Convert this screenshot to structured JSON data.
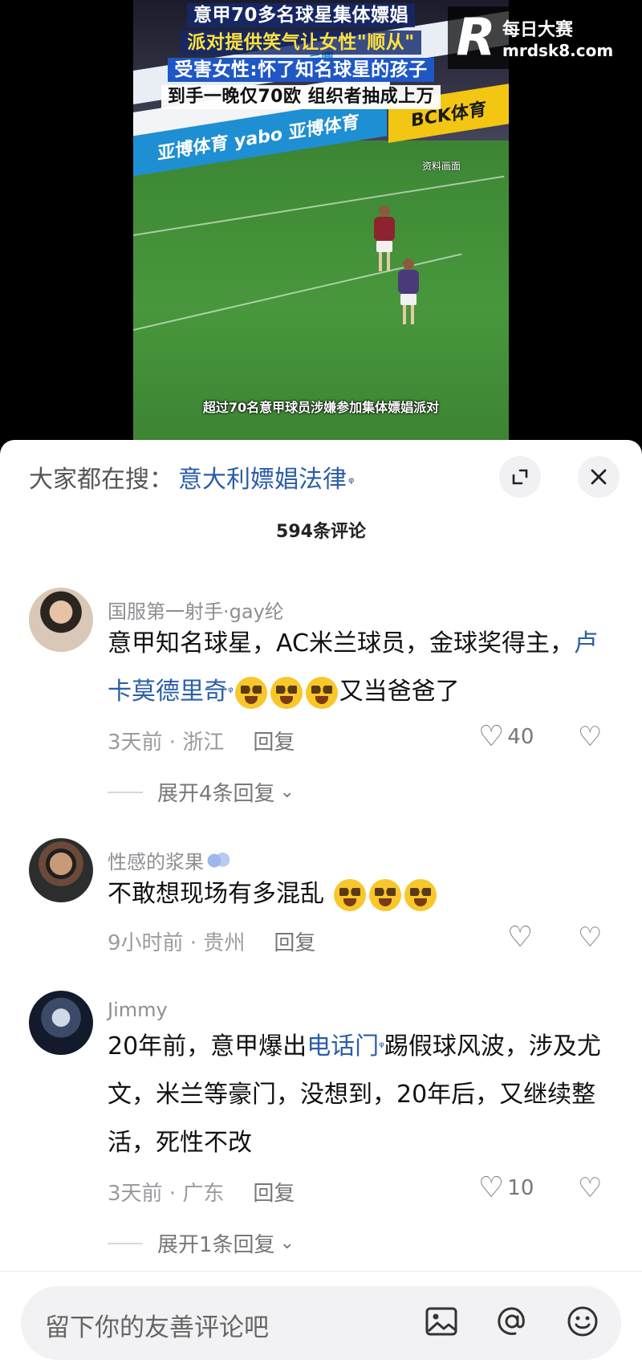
{
  "video": {
    "headline_lines": [
      "意甲70多名球星集体嫖娼",
      "派对提供笑气让女性\"顺从\"",
      "受害女性:怀了知名球星的孩子",
      "到手一晚仅70欧 组织者抽成上万"
    ],
    "source_tag": "资料画面",
    "subtitle": "超过70名意甲球员涉嫌参加集体嫖娼派对",
    "watermark": {
      "brand_cn": "每日大赛",
      "url": "mrdsk8.com",
      "logo_letter": "R"
    },
    "boards": {
      "blue": "亚博体育 yabo 亚博体育",
      "yellow": "BCK体育",
      "top": "云鼎"
    }
  },
  "sheet": {
    "search_prefix": "大家都在搜：",
    "search_term": "意大利嫖娼法律",
    "comment_count": "594条评论"
  },
  "comments": [
    {
      "name": "国服第一射手·gay纶",
      "text_a": "意甲知名球星，AC米兰球员，金球奖得主，",
      "link": "卢卡莫德里奇",
      "text_b": "又当爸爸了",
      "time": "3天前 · 浙江",
      "reply": "回复",
      "likes": "40",
      "expand": "展开4条回复"
    },
    {
      "name": "性感的浆果",
      "text_a": "不敢想现场有多混乱 ",
      "time": "9小时前 · 贵州",
      "reply": "回复"
    },
    {
      "name": "Jimmy",
      "text_a": "20年前，意甲爆出",
      "link": "电话门",
      "text_b": "踢假球风波，涉及尤文，米兰等豪门，没想到，20年后，又继续整活，死性不改",
      "time": "3天前 · 广东",
      "reply": "回复",
      "likes": "10",
      "expand": "展开1条回复"
    }
  ],
  "input": {
    "placeholder": "留下你的友善评论吧"
  },
  "icons": {
    "search_suffix": "search-icon",
    "expand": "expand-icon",
    "close": "close-icon",
    "like": "heart-icon",
    "dislike": "broken-heart-icon",
    "image": "image-icon",
    "mention": "at-icon",
    "emoji": "emoji-icon"
  }
}
